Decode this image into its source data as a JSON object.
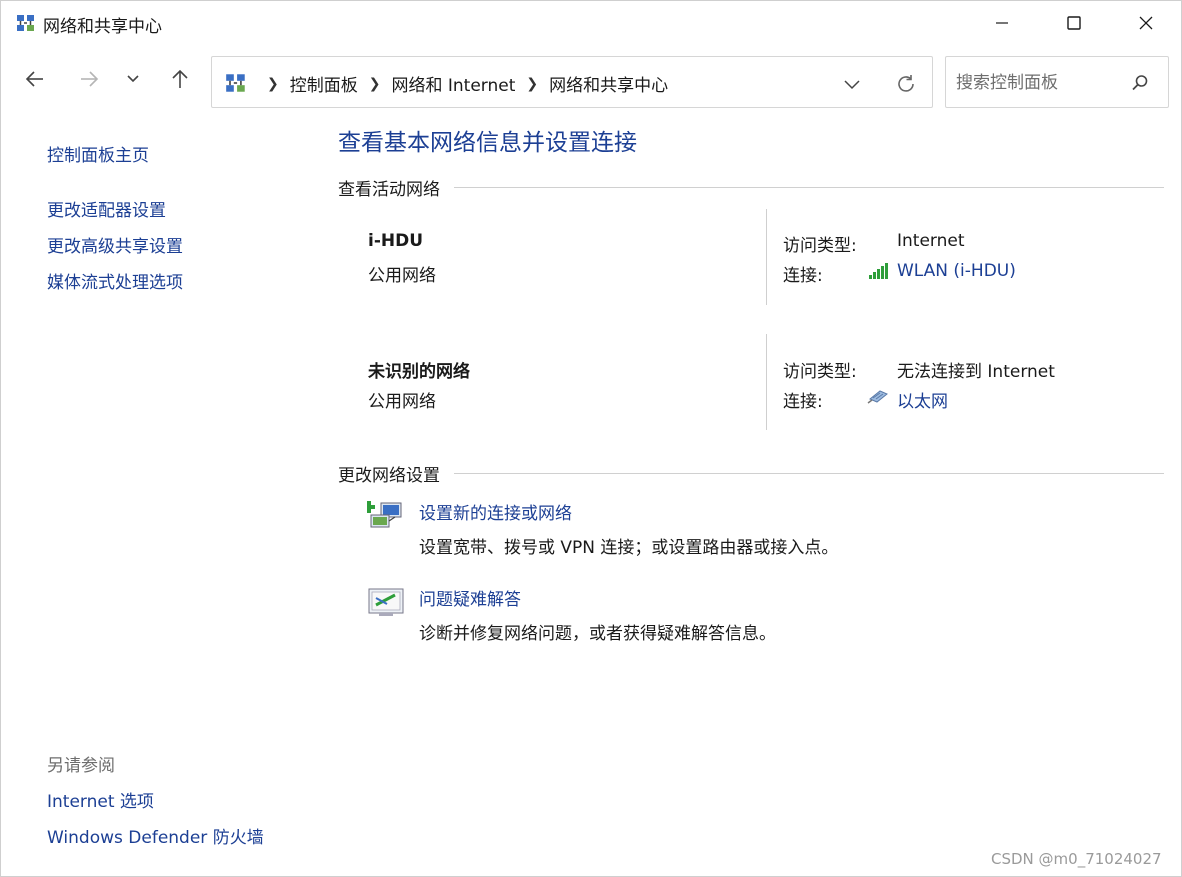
{
  "window": {
    "title": "网络和共享中心"
  },
  "navigation": {
    "breadcrumbs": [
      "控制面板",
      "网络和 Internet",
      "网络和共享中心"
    ],
    "search_placeholder": "搜索控制面板"
  },
  "sidebar": {
    "home": "控制面板主页",
    "links": [
      "更改适配器设置",
      "更改高级共享设置",
      "媒体流式处理选项"
    ],
    "see_also_heading": "另请参阅",
    "see_also": [
      "Internet 选项",
      "Windows Defender 防火墙"
    ]
  },
  "main": {
    "title": "查看基本网络信息并设置连接",
    "active_networks_heading": "查看活动网络",
    "networks": [
      {
        "name": "i-HDU",
        "category": "公用网络",
        "access_type_label": "访问类型:",
        "access_type": "Internet",
        "connection_label": "连接:",
        "connection": "WLAN (i-HDU)",
        "connection_icon": "wifi-signal-icon"
      },
      {
        "name": "未识别的网络",
        "category": "公用网络",
        "access_type_label": "访问类型:",
        "access_type": "无法连接到 Internet",
        "connection_label": "连接:",
        "connection": "以太网",
        "connection_icon": "ethernet-icon"
      }
    ],
    "change_settings_heading": "更改网络设置",
    "tasks": [
      {
        "link": "设置新的连接或网络",
        "description": "设置宽带、拨号或 VPN 连接；或设置路由器或接入点。",
        "icon": "new-connection-icon"
      },
      {
        "link": "问题疑难解答",
        "description": "诊断并修复网络问题，或者获得疑难解答信息。",
        "icon": "troubleshoot-icon"
      }
    ]
  },
  "watermark": "CSDN @m0_71024027",
  "colors": {
    "link": "#1c3f94",
    "text": "#1a1a1a",
    "muted": "#6d6d6d",
    "wifi_green": "#2e9e3a"
  }
}
